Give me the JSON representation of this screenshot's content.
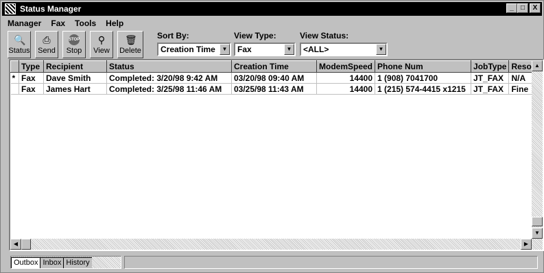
{
  "window": {
    "title": "Status Manager"
  },
  "window_buttons": {
    "minimize": "_",
    "maximize": "□",
    "close": "X"
  },
  "menu": [
    "Manager",
    "Fax",
    "Tools",
    "Help"
  ],
  "toolbar": {
    "buttons": [
      {
        "label": "Status",
        "icon": "status-icon"
      },
      {
        "label": "Send",
        "icon": "send-icon"
      },
      {
        "label": "Stop",
        "icon": "stop-icon",
        "icon_text": "STOP"
      },
      {
        "label": "View",
        "icon": "magnifier-icon"
      },
      {
        "label": "Delete",
        "icon": "trash-icon"
      }
    ],
    "sort_by": {
      "label": "Sort By:",
      "value": "Creation Time"
    },
    "view_type": {
      "label": "View Type:",
      "value": "Fax"
    },
    "view_status": {
      "label": "View Status:",
      "value": "<ALL>"
    }
  },
  "table": {
    "columns": [
      "",
      "Type",
      "Recipient",
      "Status",
      "Creation Time",
      "ModemSpeed",
      "Phone Num",
      "JobType",
      "Resol"
    ],
    "rows": [
      [
        "*",
        "Fax",
        "Dave Smith",
        "Completed: 3/20/98 9:42 AM",
        "03/20/98 09:40 AM",
        "14400",
        "1 (908) 7041700",
        "JT_FAX",
        "N/A"
      ],
      [
        "",
        "Fax",
        "James  Hart",
        "Completed: 3/25/98 11:46 AM",
        "03/25/98 11:43 AM",
        "14400",
        "1 (215) 574-4415 x1215",
        "JT_FAX",
        "Fine"
      ]
    ]
  },
  "tabs": [
    "Outbox",
    "Inbox",
    "History"
  ],
  "active_tab": "Outbox"
}
